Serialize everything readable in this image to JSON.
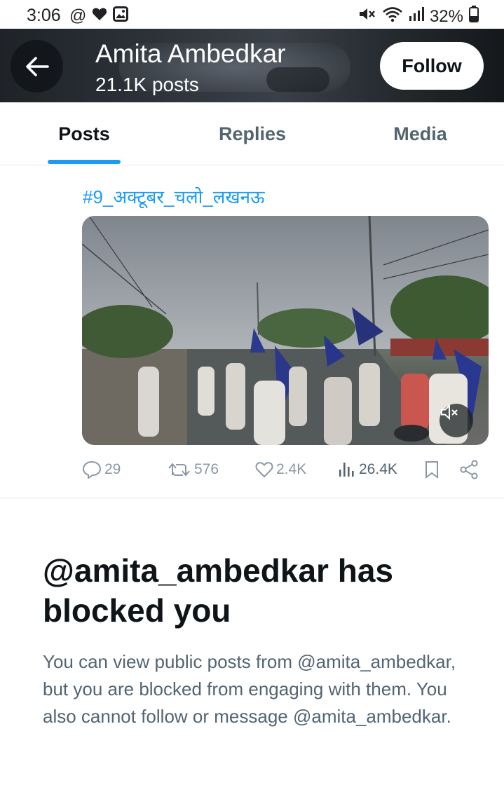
{
  "status_bar": {
    "time": "3:06",
    "left_icons": [
      "at-sign-icon",
      "heart-icon",
      "image-icon"
    ],
    "at_symbol": "@",
    "right_icons": [
      "mute-icon",
      "wifi-icon",
      "signal-icon",
      "battery-icon"
    ],
    "battery": "32%"
  },
  "header": {
    "name": "Amita Ambedkar",
    "post_count": "21.1K posts",
    "follow_label": "Follow"
  },
  "tabs": [
    {
      "label": "Posts",
      "active": true
    },
    {
      "label": "Replies",
      "active": false
    },
    {
      "label": "Media",
      "active": false
    }
  ],
  "post": {
    "hashtag": "#9_अक्टूबर_चलो_लखनऊ",
    "media_type": "video",
    "muted": true,
    "stats": {
      "replies": "29",
      "reposts": "576",
      "likes": "2.4K",
      "views": "26.4K"
    }
  },
  "blocked": {
    "title": "@amita_ambedkar has blocked you",
    "description": "You can view public posts from @amita_ambedkar, but you are blocked from engaging with them. You also cannot follow or message @amita_ambedkar."
  },
  "colors": {
    "accent": "#1d9bf0",
    "text_primary": "#0f1419",
    "text_secondary": "#536471",
    "icon_muted": "#8b98a5"
  }
}
